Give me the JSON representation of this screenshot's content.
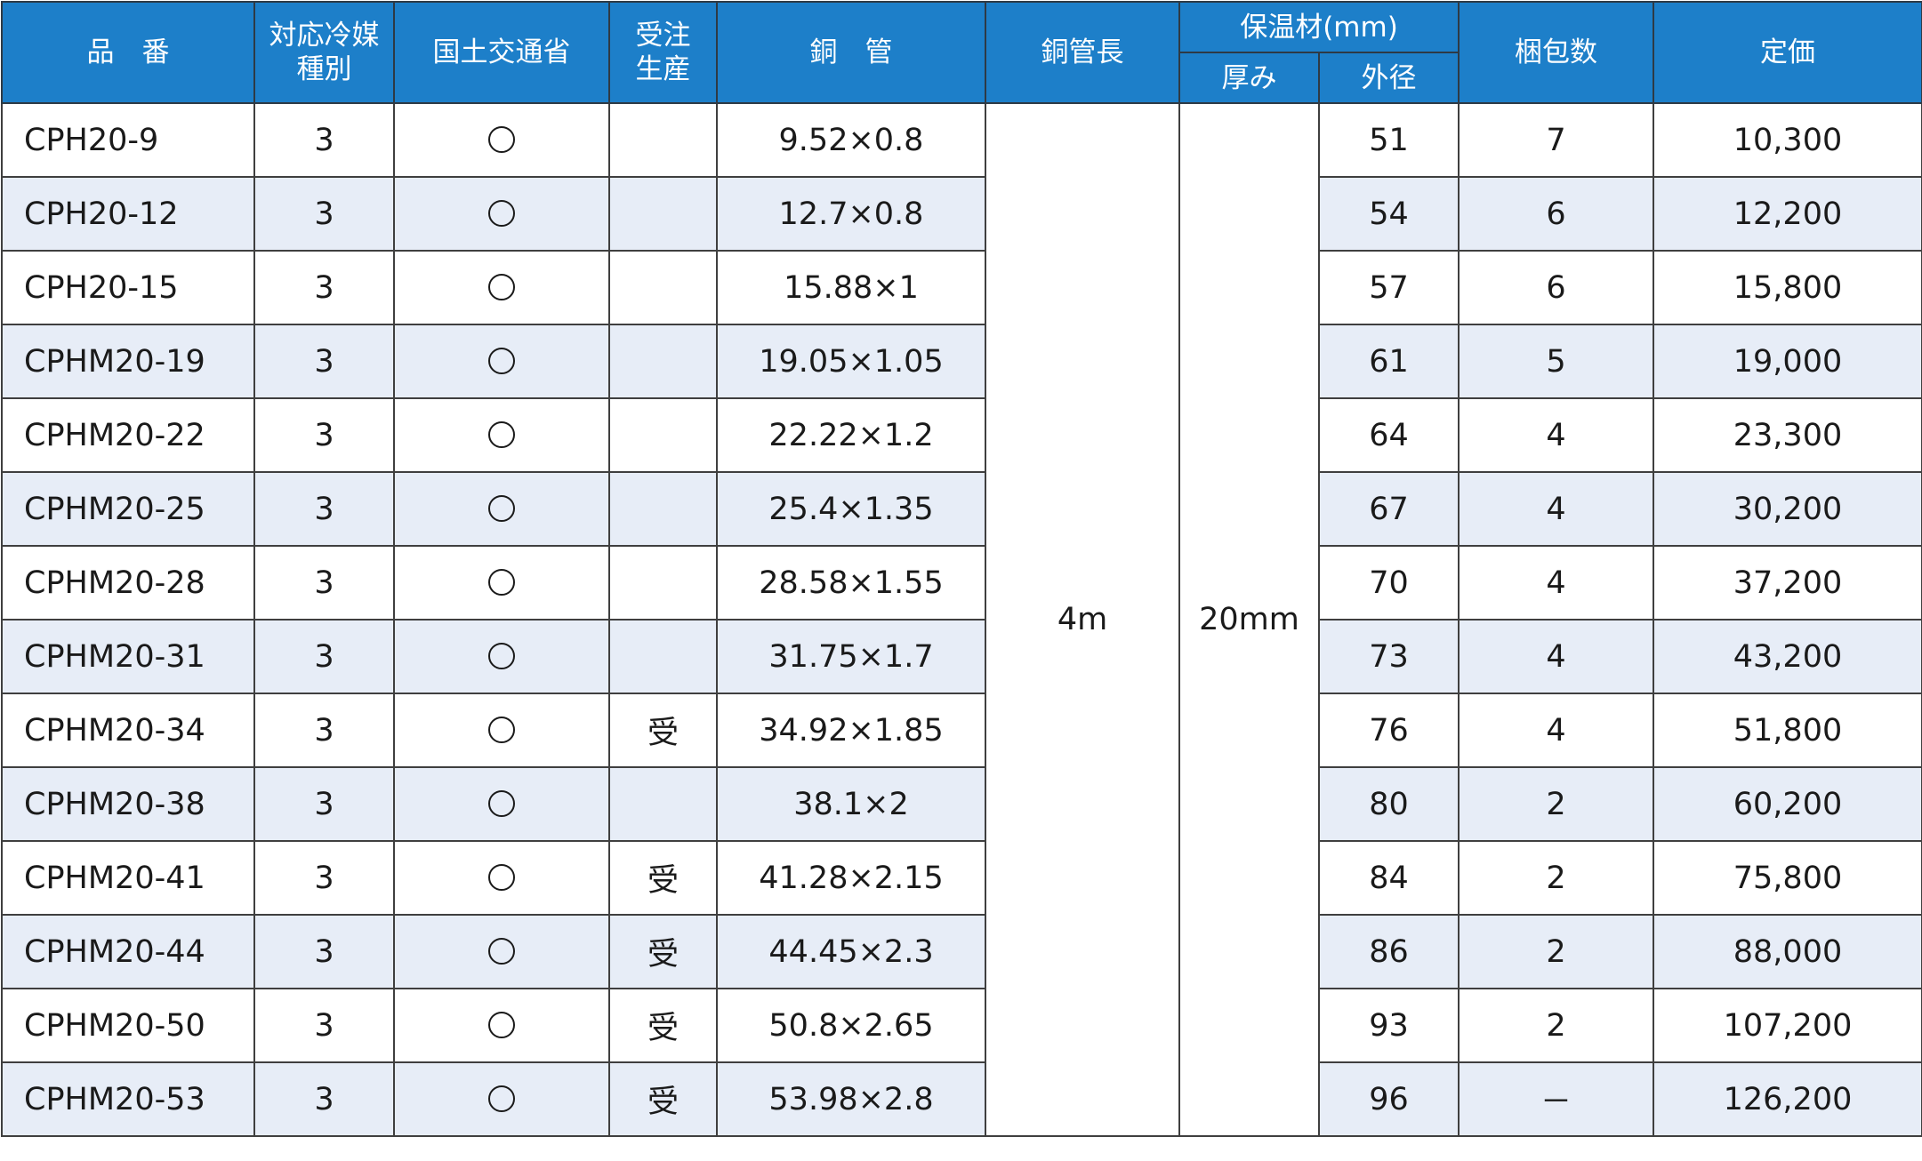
{
  "header": {
    "code": "品　番",
    "refrigerant": "対応冷媒種別",
    "refrigerant_l1": "対応冷媒",
    "refrigerant_l2": "種別",
    "mlit": "国土交通省",
    "order_l1": "受注",
    "order_l2": "生産",
    "pipe": "銅　管",
    "pipe_length": "銅管長",
    "insulation": "保温材(mm)",
    "thickness": "厚み",
    "outer_dia": "外径",
    "pack": "梱包数",
    "price": "定価"
  },
  "merged": {
    "pipe_length": "4m",
    "thickness": "20mm"
  },
  "rows": [
    {
      "code": "CPH20-9",
      "ref": "3",
      "order": "",
      "pipe": "9.52×0.8",
      "od": "51",
      "pack": "7",
      "price": "10,300"
    },
    {
      "code": "CPH20-12",
      "ref": "3",
      "order": "",
      "pipe": "12.7×0.8",
      "od": "54",
      "pack": "6",
      "price": "12,200"
    },
    {
      "code": "CPH20-15",
      "ref": "3",
      "order": "",
      "pipe": "15.88×1",
      "od": "57",
      "pack": "6",
      "price": "15,800"
    },
    {
      "code": "CPHM20-19",
      "ref": "3",
      "order": "",
      "pipe": "19.05×1.05",
      "od": "61",
      "pack": "5",
      "price": "19,000"
    },
    {
      "code": "CPHM20-22",
      "ref": "3",
      "order": "",
      "pipe": "22.22×1.2",
      "od": "64",
      "pack": "4",
      "price": "23,300"
    },
    {
      "code": "CPHM20-25",
      "ref": "3",
      "order": "",
      "pipe": "25.4×1.35",
      "od": "67",
      "pack": "4",
      "price": "30,200"
    },
    {
      "code": "CPHM20-28",
      "ref": "3",
      "order": "",
      "pipe": "28.58×1.55",
      "od": "70",
      "pack": "4",
      "price": "37,200"
    },
    {
      "code": "CPHM20-31",
      "ref": "3",
      "order": "",
      "pipe": "31.75×1.7",
      "od": "73",
      "pack": "4",
      "price": "43,200"
    },
    {
      "code": "CPHM20-34",
      "ref": "3",
      "order": "受",
      "pipe": "34.92×1.85",
      "od": "76",
      "pack": "4",
      "price": "51,800"
    },
    {
      "code": "CPHM20-38",
      "ref": "3",
      "order": "",
      "pipe": "38.1×2",
      "od": "80",
      "pack": "2",
      "price": "60,200"
    },
    {
      "code": "CPHM20-41",
      "ref": "3",
      "order": "受",
      "pipe": "41.28×2.15",
      "od": "84",
      "pack": "2",
      "price": "75,800"
    },
    {
      "code": "CPHM20-44",
      "ref": "3",
      "order": "受",
      "pipe": "44.45×2.3",
      "od": "86",
      "pack": "2",
      "price": "88,000"
    },
    {
      "code": "CPHM20-50",
      "ref": "3",
      "order": "受",
      "pipe": "50.8×2.65",
      "od": "93",
      "pack": "2",
      "price": "107,200"
    },
    {
      "code": "CPHM20-53",
      "ref": "3",
      "order": "受",
      "pipe": "53.98×2.8",
      "od": "96",
      "pack": "－",
      "price": "126,200"
    }
  ],
  "mlit_mark": "circle-mark-icon",
  "colors": {
    "header_bg": "#1d7fc9",
    "header_text": "#ffffff",
    "stripe": "#e7edf7",
    "border": "#3f3f3f"
  }
}
